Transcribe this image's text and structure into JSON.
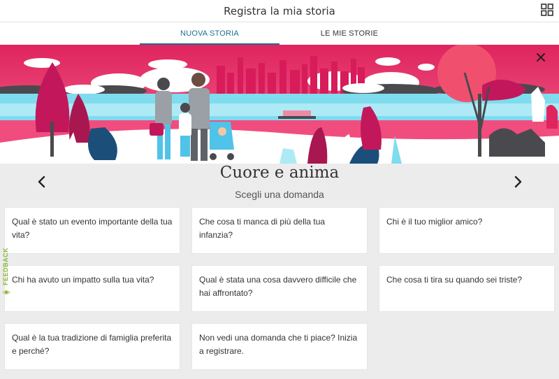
{
  "header": {
    "title": "Registra la mia storia",
    "menu_icon": "grid-icon"
  },
  "tabs": [
    {
      "label": "NUOVA STORIA",
      "active": true
    },
    {
      "label": "LE MIE STORIE",
      "active": false
    }
  ],
  "hero": {
    "close_icon": "close-icon",
    "accent_color": "#e0245e"
  },
  "category": {
    "title": "Cuore e anima",
    "subtitle": "Scegli una domanda",
    "prev_icon": "chevron-left-icon",
    "next_icon": "chevron-right-icon"
  },
  "questions": [
    "Qual è stato un evento importante della tua vita?",
    "Che cosa ti manca di più della tua infanzia?",
    "Chi è il tuo miglior amico?",
    "Chi ha avuto un impatto sulla tua vita?",
    "Qual è stata una cosa davvero difficile che hai affrontato?",
    "Che cosa ti tira su quando sei triste?",
    "Qual è la tua tradizione di famiglia preferita e perché?",
    "Non vedi una domanda che ti piace? Inizia a registrare."
  ],
  "feedback": {
    "label": "FEEDBACK",
    "color": "#8ab73a"
  }
}
